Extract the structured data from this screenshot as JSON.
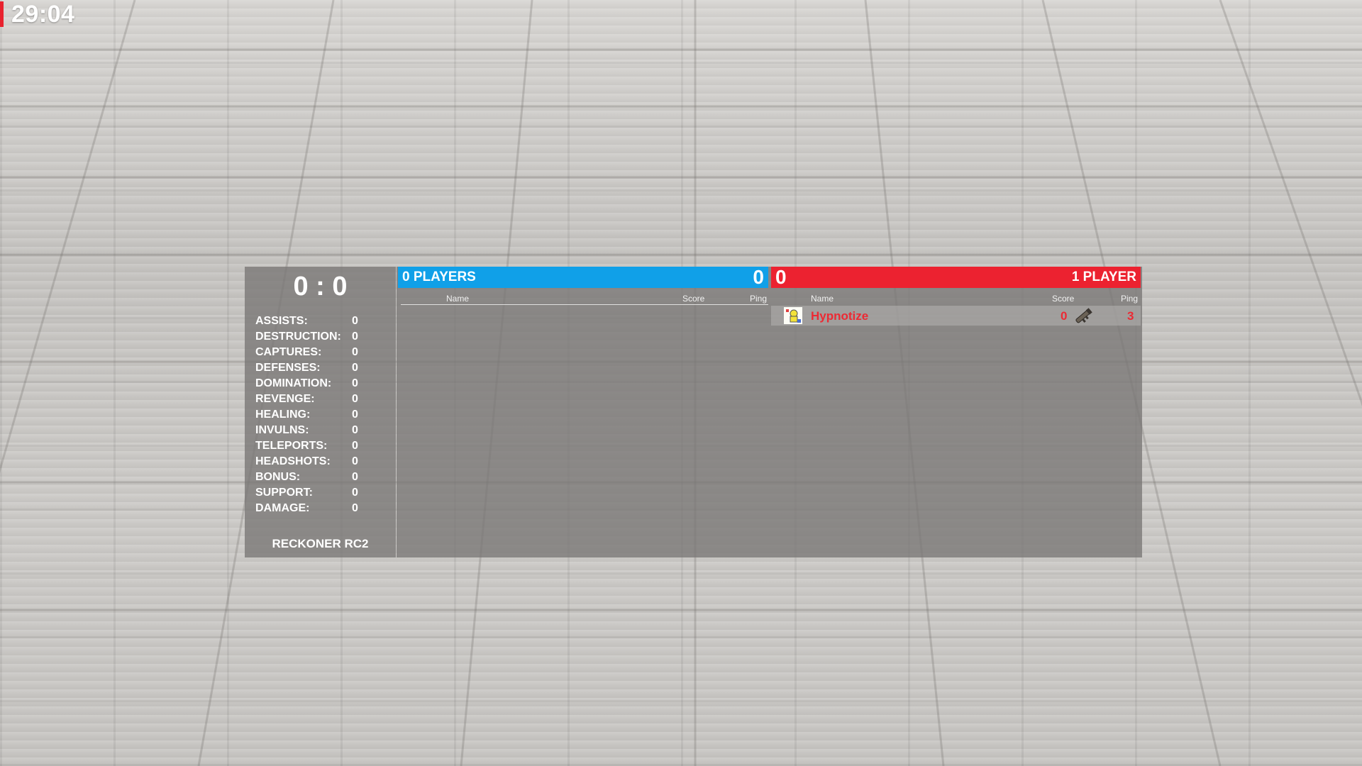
{
  "hud": {
    "round_timer": "29:04"
  },
  "stats": {
    "total_score": "0 : 0",
    "rows": [
      {
        "label": "ASSISTS:",
        "value": "0"
      },
      {
        "label": "DESTRUCTION:",
        "value": "0"
      },
      {
        "label": "CAPTURES:",
        "value": "0"
      },
      {
        "label": "DEFENSES:",
        "value": "0"
      },
      {
        "label": "DOMINATION:",
        "value": "0"
      },
      {
        "label": "REVENGE:",
        "value": "0"
      },
      {
        "label": "HEALING:",
        "value": "0"
      },
      {
        "label": "INVULNS:",
        "value": "0"
      },
      {
        "label": "TELEPORTS:",
        "value": "0"
      },
      {
        "label": "HEADSHOTS:",
        "value": "0"
      },
      {
        "label": "BONUS:",
        "value": "0"
      },
      {
        "label": "SUPPORT:",
        "value": "0"
      },
      {
        "label": "DAMAGE:",
        "value": "0"
      }
    ],
    "weapon_name": "RECKONER RC2"
  },
  "teams": {
    "blu": {
      "count_label": "0 PLAYERS",
      "score": "0",
      "color": "#10a0e8",
      "columns": {
        "name": "Name",
        "score": "Score",
        "ping": "Ping"
      },
      "players": []
    },
    "red": {
      "count_label": "1 PLAYER",
      "score": "0",
      "color": "#ec2230",
      "columns": {
        "name": "Name",
        "score": "Score",
        "ping": "Ping"
      },
      "players": [
        {
          "name": "Hypnotize",
          "score": "0",
          "ping": "3",
          "avatar_icon": "player-avatar-icon",
          "class_icon": "rocket-launcher-icon"
        }
      ]
    }
  }
}
